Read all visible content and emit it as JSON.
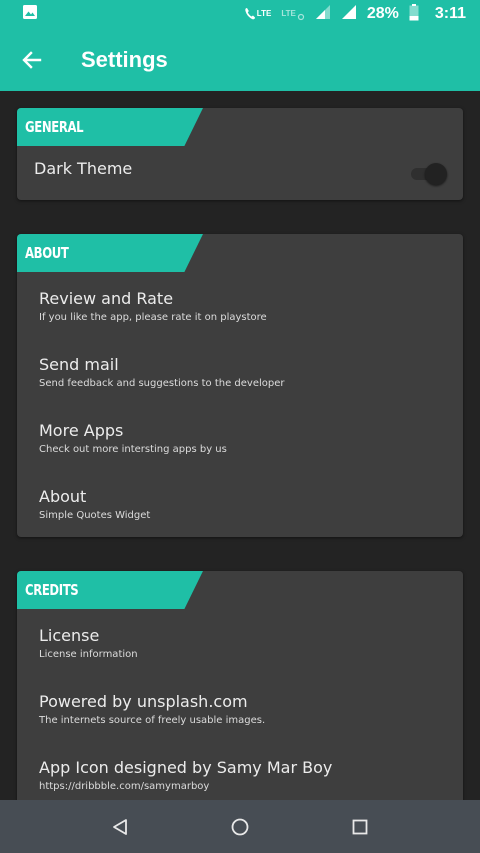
{
  "status_bar": {
    "lte_label": "LTE",
    "lte2_label": "LTE",
    "battery_percent": "28%",
    "time": "3:11"
  },
  "app_bar": {
    "title": "Settings"
  },
  "sections": {
    "general": {
      "header": "GENERAL",
      "dark_theme_label": "Dark Theme",
      "dark_theme_enabled": false
    },
    "about": {
      "header": "ABOUT",
      "items": [
        {
          "title": "Review and Rate",
          "subtitle": "If you like the app, please rate it on playstore"
        },
        {
          "title": "Send mail",
          "subtitle": "Send feedback and suggestions to the developer"
        },
        {
          "title": "More Apps",
          "subtitle": "Check out more intersting apps by us"
        },
        {
          "title": "About",
          "subtitle": "Simple Quotes Widget"
        }
      ]
    },
    "credits": {
      "header": "CREDITS",
      "items": [
        {
          "title": "License",
          "subtitle": "License information"
        },
        {
          "title": "Powered by unsplash.com",
          "subtitle": "The internets source of freely usable images."
        },
        {
          "title": "App Icon designed by Samy Mar Boy",
          "subtitle": "https://dribbble.com/samymarboy"
        }
      ]
    }
  },
  "colors": {
    "accent": "#1fbfa6",
    "card": "#3e3e3e",
    "background": "#232323",
    "navbar": "#474d54"
  }
}
